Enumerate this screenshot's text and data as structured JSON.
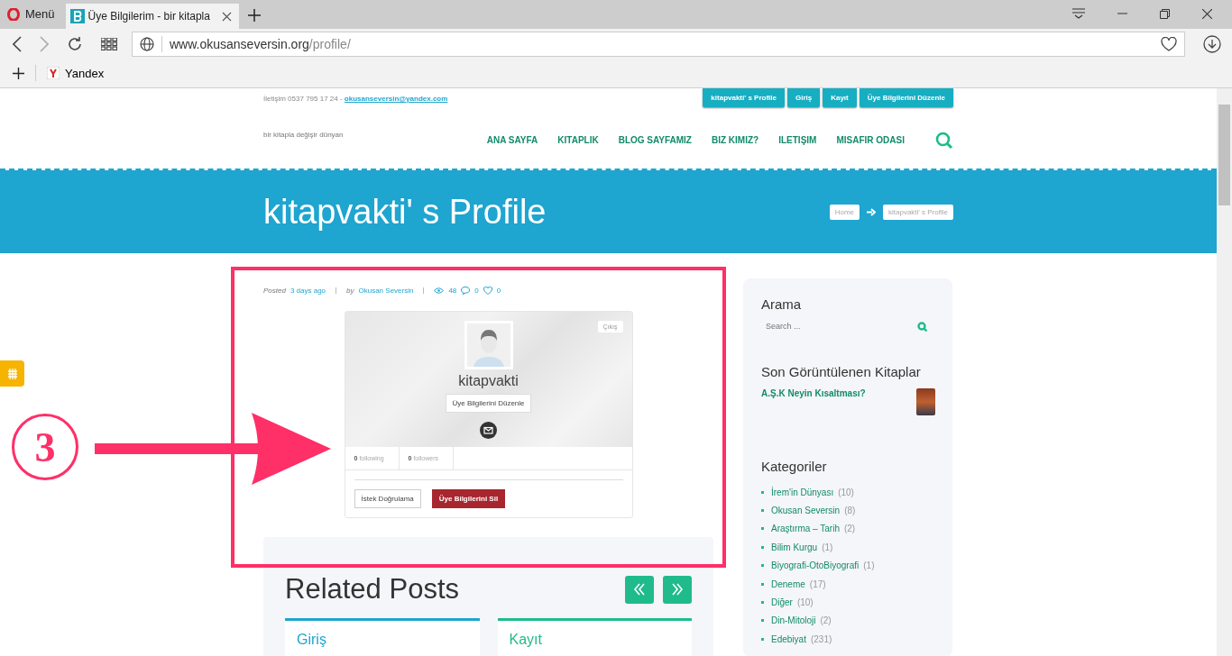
{
  "browser": {
    "menu_label": "Menü",
    "tabs": [
      {
        "title": "Üye Bilgilerim - bir kitapla",
        "selected": true
      }
    ],
    "url_host": "www.okusanseversin.org",
    "url_path": "/profile/",
    "bookmarks": [
      {
        "label": "Yandex"
      }
    ]
  },
  "header": {
    "contact_prefix": "İletişim 0537 795 17 24 -",
    "contact_email": "okusanseversin@yandex.com",
    "top_buttons": [
      "kitapvakti' s Profile",
      "Giriş",
      "Kayıt",
      "Üye Bilgilerini Düzenle"
    ],
    "tagline": "bir kitapla değişir dünyan",
    "nav": [
      "ANA SAYFA",
      "KITAPLIK",
      "BLOG SAYFAMIZ",
      "BIZ KIMIZ?",
      "ILETIŞIM",
      "MISAFIR ODASI"
    ]
  },
  "banner": {
    "title": "kitapvakti' s Profile",
    "breadcrumbs": [
      "Home",
      "kitapvakti' s Profile"
    ]
  },
  "post_meta": {
    "posted_label": "Posted",
    "posted_time": "3 days ago",
    "by_label": "by",
    "author": "Okusan Seversin",
    "views": "48",
    "comments": "0",
    "likes": "0"
  },
  "profile": {
    "logout": "Çıkış",
    "username": "kitapvakti",
    "edit_button": "Üye Bilgilerini Düzenle",
    "stats": [
      {
        "count": "0",
        "label": "following"
      },
      {
        "count": "0",
        "label": "followers"
      }
    ],
    "actions": [
      {
        "label": "İstek Doğrulama",
        "kind": "secondary"
      },
      {
        "label": "Üye Bilgilerini Sil",
        "kind": "danger"
      }
    ]
  },
  "related": {
    "title": "Related Posts",
    "posts": [
      {
        "title": "Giriş",
        "color": "#1ea5d0"
      },
      {
        "title": "Kayıt",
        "color": "#1fbb8c"
      }
    ]
  },
  "sidebar": {
    "search_title": "Arama",
    "search_placeholder": "Search ...",
    "recent_title": "Son Görüntülenen Kitaplar",
    "recent_books": [
      {
        "title": "A.Ş.K Neyin Kısaltması?"
      }
    ],
    "categories_title": "Kategoriler",
    "categories": [
      {
        "name": "İrem'in Dünyası",
        "count": "(10)"
      },
      {
        "name": "Okusan Seversin",
        "count": "(8)"
      },
      {
        "name": "Araştırma – Tarih",
        "count": "(2)"
      },
      {
        "name": "Bilim Kurgu",
        "count": "(1)"
      },
      {
        "name": "Biyografi-OtoBiyografi",
        "count": "(1)"
      },
      {
        "name": "Deneme",
        "count": "(17)"
      },
      {
        "name": "Diğer",
        "count": "(10)"
      },
      {
        "name": "Din-Mitoloji",
        "count": "(2)"
      },
      {
        "name": "Edebiyat",
        "count": "(231)"
      }
    ]
  },
  "annotation": {
    "step": "3"
  }
}
